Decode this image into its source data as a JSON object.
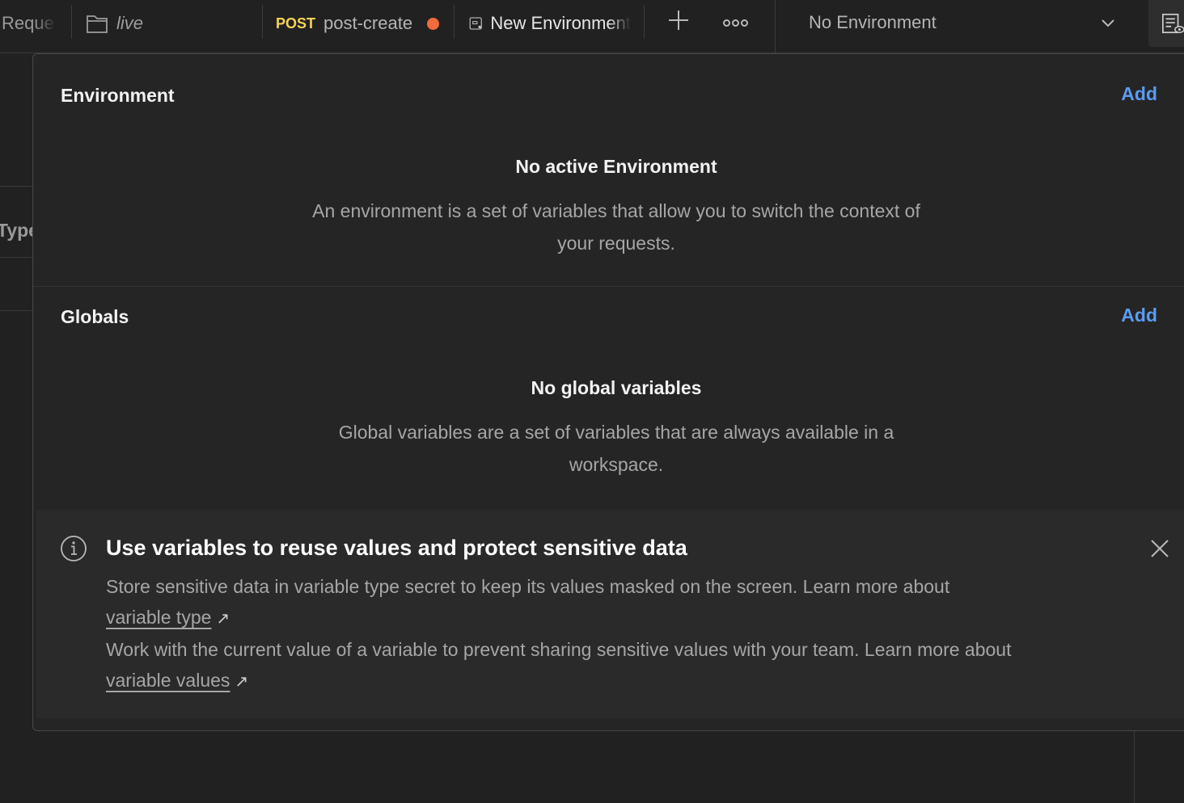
{
  "tabs": {
    "reque": "Reque",
    "live": "live",
    "post_method": "POST",
    "post_name": "post-create",
    "env_tab": "New Environment"
  },
  "env_selector": {
    "value": "No Environment"
  },
  "background": {
    "type_label": "Type"
  },
  "environment": {
    "title": "Environment",
    "add": "Add",
    "empty_title": "No active Environment",
    "empty_desc": "An environment is a set of variables that allow you to switch the context of your requests."
  },
  "globals": {
    "title": "Globals",
    "add": "Add",
    "empty_title": "No global variables",
    "empty_desc": "Global variables are a set of variables that are always available in a workspace."
  },
  "banner": {
    "title": "Use variables to reuse values and protect sensitive data",
    "line1": "Store sensitive data in variable type secret to keep its values masked on the screen. Learn more about",
    "link1": "variable type",
    "line2": "Work with the current value of a variable to prevent sharing sensitive values with your team. Learn more about",
    "link2": "variable values"
  },
  "colors": {
    "accent": "#5a9cf2",
    "method_post": "#f6d357",
    "unsaved_dot": "#f26b3a",
    "background": "#212121",
    "panel": "#252525"
  }
}
